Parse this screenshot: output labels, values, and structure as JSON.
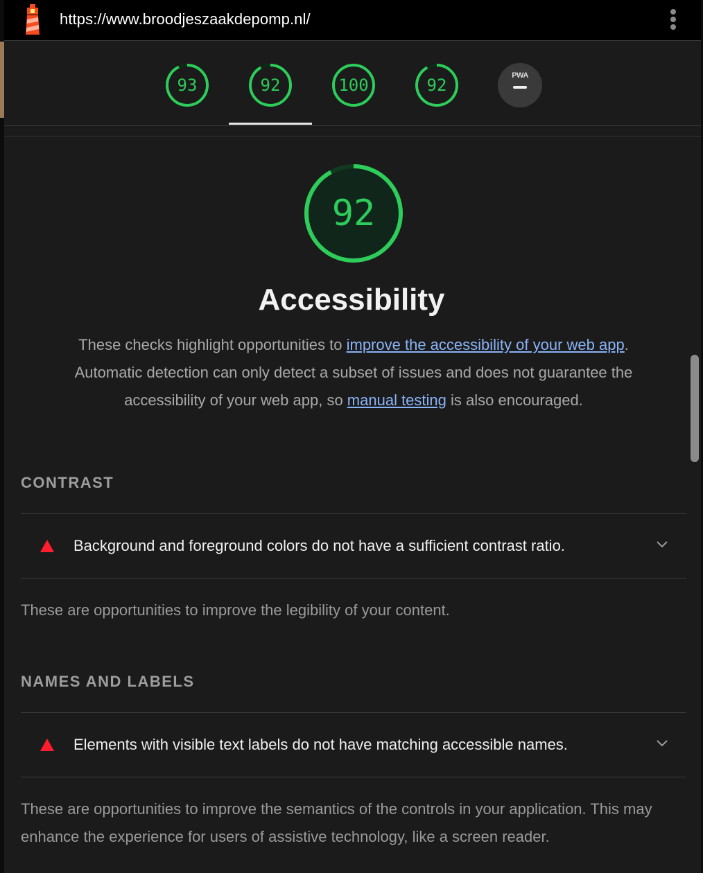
{
  "browser": {
    "url": "https://www.broodjeszaakdepomp.nl/"
  },
  "category_gauges": [
    {
      "value": "93",
      "score": 0.93,
      "color": "#2ecc5a"
    },
    {
      "value": "92",
      "score": 0.92,
      "color": "#2ecc5a",
      "active": true
    },
    {
      "value": "100",
      "score": 1.0,
      "color": "#2ecc5a"
    },
    {
      "value": "92",
      "score": 0.92,
      "color": "#2ecc5a"
    },
    {
      "label": "PWA",
      "value": "—"
    }
  ],
  "main": {
    "score": "92",
    "score_fraction": 0.92,
    "title": "Accessibility",
    "description": {
      "part1": "These checks highlight opportunities to ",
      "link1": "improve the accessibility of your web app",
      "part2": ". Automatic detection can only detect a subset of issues and does not guarantee the accessibility of your web app, so ",
      "link2": "manual testing",
      "part3": " is also encouraged."
    }
  },
  "sections": [
    {
      "heading": "CONTRAST",
      "audit": "Background and foreground colors do not have a sufficient contrast ratio.",
      "note": "These are opportunities to improve the legibility of your content."
    },
    {
      "heading": "NAMES AND LABELS",
      "audit": "Elements with visible text labels do not have matching accessible names.",
      "note": "These are opportunities to improve the semantics of the controls in your application. This may enhance the experience for users of assistive technology, like a screen reader."
    }
  ],
  "colors": {
    "pass": "#2ecc5a",
    "fail": "#ff1e2e",
    "link": "#8ab4f8"
  }
}
